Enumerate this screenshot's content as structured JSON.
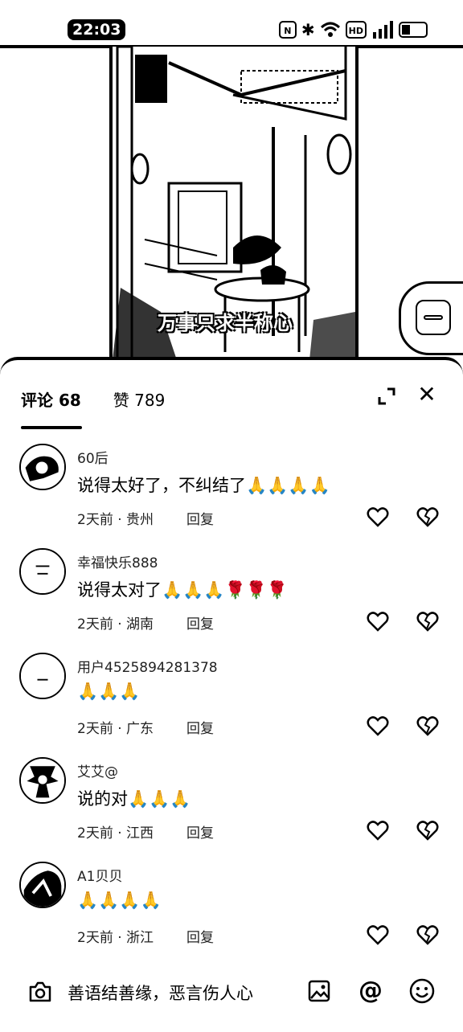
{
  "status_bar": {
    "time": "22:03",
    "icons": [
      "nfc-icon",
      "bluetooth-icon",
      "wifi-icon",
      "hd-icon",
      "signal-icon",
      "battery-icon"
    ],
    "hd_label": "HD"
  },
  "video": {
    "subtitle": "万事只求半称心"
  },
  "sheet": {
    "tabs": [
      {
        "label": "评论 68",
        "active": true
      },
      {
        "label": "赞 789",
        "active": false
      }
    ]
  },
  "comments": [
    {
      "username": "60后",
      "text": "说得太好了，不纠结了🙏🙏🙏🙏",
      "time": "2天前",
      "location": "贵州",
      "reply": "回复"
    },
    {
      "username": "幸福快乐888",
      "text": "说得太对了🙏🙏🙏🌹🌹🌹",
      "time": "2天前",
      "location": "湖南",
      "reply": "回复"
    },
    {
      "username": "用户4525894281378",
      "text": "🙏🙏🙏",
      "time": "2天前",
      "location": "广东",
      "reply": "回复"
    },
    {
      "username": "艾艾@",
      "text": "说的对🙏🙏🙏",
      "time": "2天前",
      "location": "江西",
      "reply": "回复"
    },
    {
      "username": "A1贝贝",
      "text": "🙏🙏🙏🙏",
      "time": "2天前",
      "location": "浙江",
      "reply": "回复"
    }
  ],
  "input": {
    "placeholder": "善语结善缘，恶言伤人心",
    "at_symbol": "@"
  }
}
